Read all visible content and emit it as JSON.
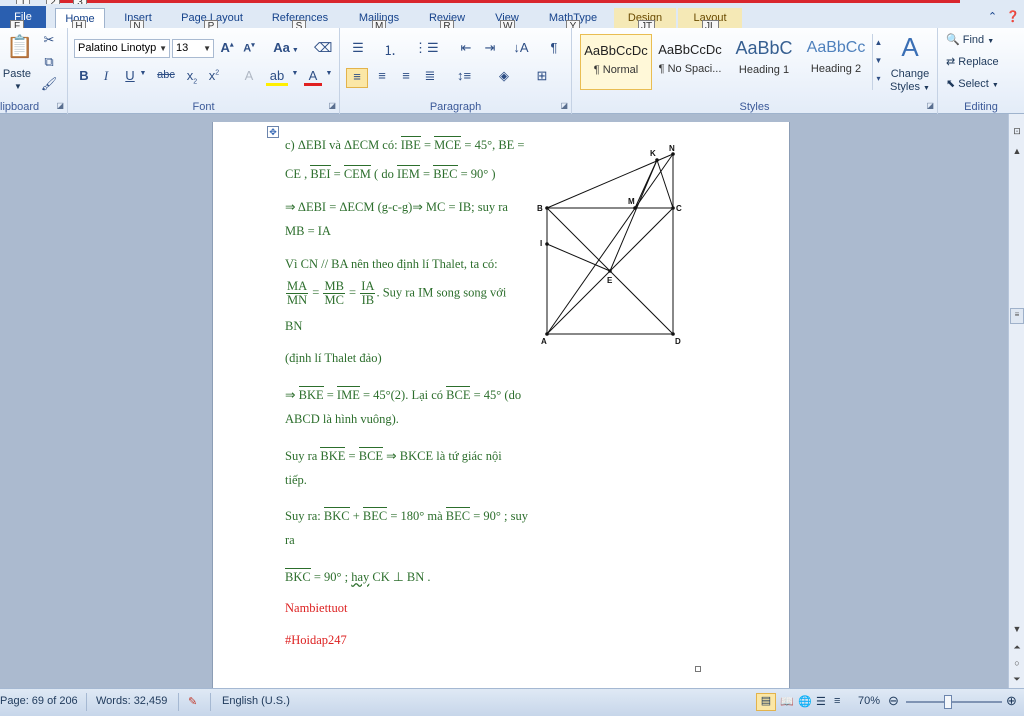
{
  "tabs": [
    {
      "label": "File",
      "key": "F"
    },
    {
      "label": "Home",
      "key": "H"
    },
    {
      "label": "Insert",
      "key": "N"
    },
    {
      "label": "Page Layout",
      "key": "P"
    },
    {
      "label": "References",
      "key": "S"
    },
    {
      "label": "Mailings",
      "key": "M"
    },
    {
      "label": "Review",
      "key": "R"
    },
    {
      "label": "View",
      "key": "W"
    },
    {
      "label": "MathType",
      "key": "Y"
    },
    {
      "label": "Design",
      "key": "JT"
    },
    {
      "label": "Layout",
      "key": "JL"
    }
  ],
  "qat_keys": [
    "1",
    "2",
    "3"
  ],
  "ribbon": {
    "clipboard": {
      "label": "lipboard",
      "paste": "Paste"
    },
    "font": {
      "label": "Font",
      "family": "Palatino Linotyp",
      "size": "13",
      "change_case": "Aa"
    },
    "paragraph": {
      "label": "Paragraph"
    },
    "styles": {
      "label": "Styles",
      "items": [
        {
          "sample": "AaBbCcDc",
          "name": "¶ Normal"
        },
        {
          "sample": "AaBbCcDc",
          "name": "¶ No Spaci..."
        },
        {
          "sample": "AaBbC",
          "name": "Heading 1"
        },
        {
          "sample": "AaBbCc",
          "name": "Heading 2"
        }
      ],
      "change_styles": [
        "Change",
        "Styles"
      ]
    },
    "editing": {
      "label": "Editing",
      "find": "Find",
      "replace": "Replace",
      "select": "Select"
    }
  },
  "document": {
    "line1": {
      "a": "c) ΔEBI  và ΔECM có: ",
      "ibe": "IBE",
      "eq": " = ",
      "mce": "MCE",
      "b": " = 45°,  BE ="
    },
    "line2": {
      "a": "CE ,  ",
      "bei": "BEI",
      "eq1": " = ",
      "cem": "CEM",
      "b": " ( do  ",
      "iem": "IEM",
      "eq2": " = ",
      "bec": "BEC",
      "c": " = 90° )"
    },
    "line3": "⇒ ΔEBI = ΔECM (g-c-g)⇒  MC = IB; suy ra",
    "line4": "MB = IA",
    "line5": "Vì CN // BA nên theo định lí Thalet, ta có:",
    "line6": {
      "f1n": "MA",
      "f1d": "MN",
      "f2n": "MB",
      "f2d": "MC",
      "f3n": "IA",
      "f3d": "IB",
      "tail": ". Suy ra IM song song với"
    },
    "line7": "BN",
    "line8": "(định lí Thalet đảo)",
    "line9": {
      "a": "⇒ ",
      "bke": "BKE",
      "eq": " = ",
      "ime": "IME",
      "b": " = 45°(2). Lại có  ",
      "bce": "BCE",
      "c": " = 45° (do"
    },
    "line10": "ABCD là hình vuông).",
    "line11": {
      "a": "Suy ra  ",
      "bke": "BKE",
      "eq": " = ",
      "bce": "BCE",
      "b": " ⇒ BKCE là tứ giác nội"
    },
    "line12": "tiếp.",
    "line13": {
      "a": "Suy ra:  ",
      "bkc": "BKC",
      "plus": " + ",
      "bec": "BEC",
      "b": " = 180° mà  ",
      "bec2": "BEC",
      "c": " = 90° ; suy"
    },
    "line14": "ra",
    "line15": {
      "bkc": "BKC",
      "a": " = 90° ; ",
      "hay": "hay",
      "b": "  CK  ⊥  BN ."
    },
    "line16": "Nambiettuot",
    "line17": "#Hoidap247"
  },
  "figure_labels": {
    "K": "K",
    "N": "N",
    "B": "B",
    "M": "M",
    "C": "C",
    "I": "I",
    "E": "E",
    "A": "A",
    "D": "D"
  },
  "status": {
    "page": "Page: 69 of 206",
    "words": "Words: 32,459",
    "language": "English (U.S.)",
    "zoom": "70%",
    "zoom_fraction": 0.44
  }
}
